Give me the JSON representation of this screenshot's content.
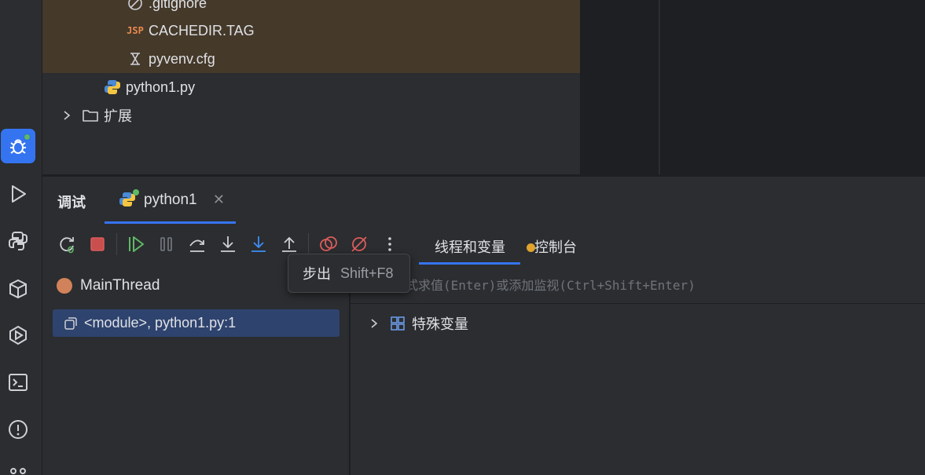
{
  "project_tree": {
    "items": [
      {
        "label": ".gitignore",
        "icon": "gitignore-icon"
      },
      {
        "label": "CACHEDIR.TAG",
        "icon": "jsp-file-icon",
        "icon_text": "JSP"
      },
      {
        "label": "pyvenv.cfg",
        "icon": "config-file-icon"
      },
      {
        "label": "python1.py",
        "icon": "python-file-icon"
      },
      {
        "label": "扩展",
        "icon": "folder-icon"
      }
    ]
  },
  "debug": {
    "title": "调试",
    "session_tab": "python1",
    "subtabs": [
      "线程和变量",
      "控制台"
    ],
    "tooltip": {
      "label": "步出",
      "shortcut": "Shift+F8"
    },
    "thread": "MainThread",
    "frame": "<module>, python1.py:1",
    "eval_placeholder": "式求值(Enter)或添加监视(Ctrl+Shift+Enter)",
    "variables": [
      {
        "label": "特殊变量"
      }
    ]
  },
  "colors": {
    "accent": "#3574f0",
    "highlight_row": "#45392a",
    "selected_frame": "#2e436e"
  }
}
